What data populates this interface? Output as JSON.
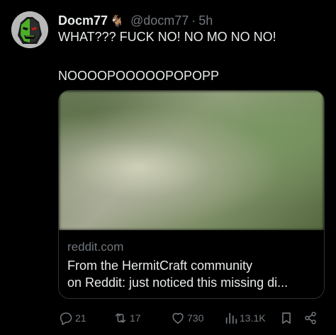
{
  "tweet": {
    "author_name": "Docm77",
    "author_emoji": "🐐",
    "handle": "@docm77",
    "separator": "·",
    "time": "5h",
    "text_line1": "WHAT??? FUCK NO! NO MO NO NO!",
    "text_line2": "NOOOOPOOOOOPOPOPP"
  },
  "card": {
    "domain": "reddit.com",
    "title_line1": "From the HermitCraft community",
    "title_line2": "on Reddit: just noticed this missing di..."
  },
  "actions": {
    "replies": "21",
    "retweets": "17",
    "likes": "730",
    "views": "13.1K"
  },
  "icons": {
    "reply": "reply-icon",
    "retweet": "retweet-icon",
    "like": "heart-icon",
    "views": "views-icon",
    "bookmark": "bookmark-icon",
    "share": "share-icon"
  },
  "colors": {
    "background": "#000000",
    "text": "#e7e9ea",
    "muted": "#71767b",
    "border": "#2f3336"
  }
}
